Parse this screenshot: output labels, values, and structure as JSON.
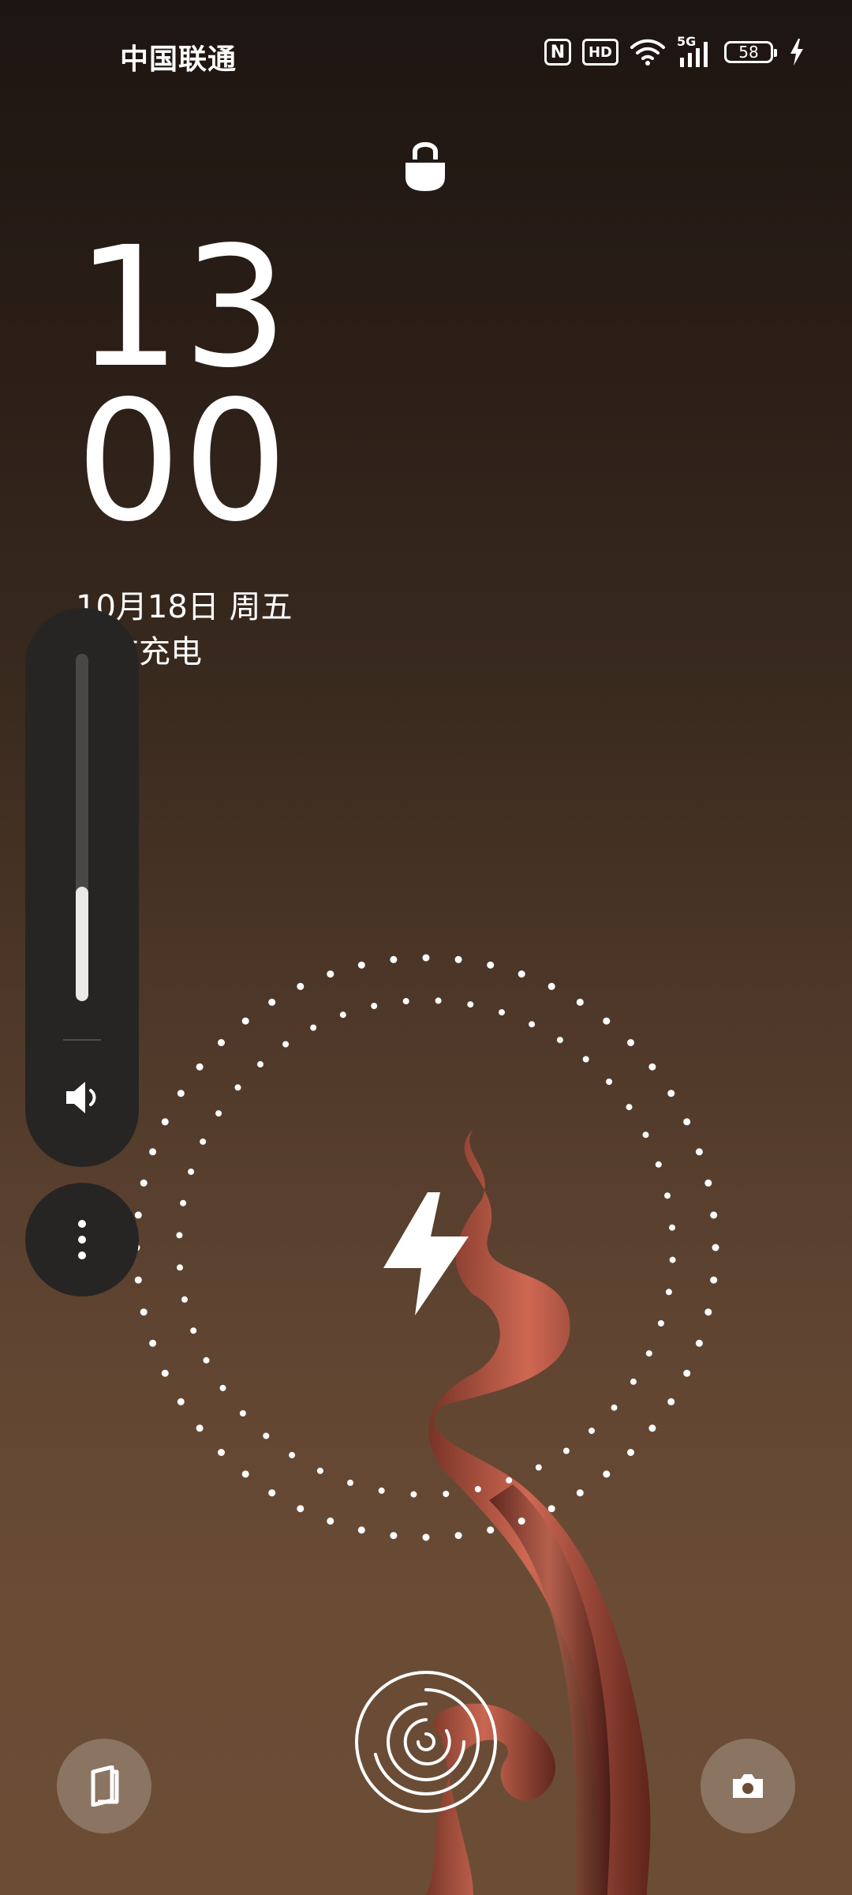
{
  "status_bar": {
    "carrier": "中国联通",
    "nfc_label": "N",
    "hd_label": "HD",
    "network_label": "5G",
    "battery_level": "58",
    "icons": [
      "nfc-icon",
      "hd-icon",
      "wifi-icon",
      "signal-5g-icon",
      "battery-icon",
      "charging-bolt-icon"
    ]
  },
  "lockscreen": {
    "hour": "13",
    "minute": "00",
    "date": "10月18日 周五",
    "status": "正在充电"
  },
  "volume": {
    "level_fraction": 0.33,
    "icons": [
      "speaker-icon",
      "more-vertical-icon"
    ]
  },
  "charging_ring": {
    "icon": "lightning-bolt-icon"
  },
  "bottom": {
    "left_shortcut_icon": "device-icon",
    "right_shortcut_icon": "camera-icon",
    "unlock_icon": "fingerprint-icon"
  },
  "colors": {
    "panel_bg": "#272523",
    "bg_top": "#1d1512",
    "bg_bottom": "#6b4d36",
    "ribbon": "#c95a45"
  }
}
